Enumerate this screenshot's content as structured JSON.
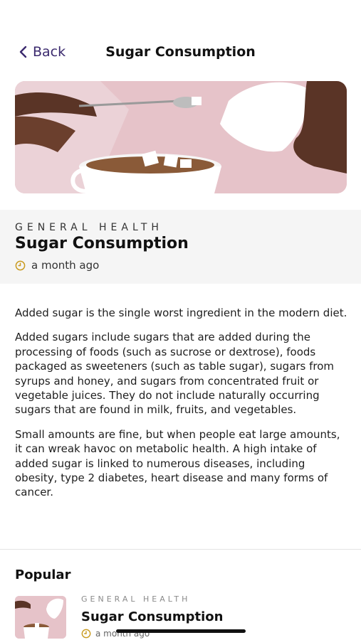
{
  "nav": {
    "back_label": "Back",
    "title": "Sugar Consumption"
  },
  "article": {
    "category": "GENERAL HEALTH",
    "title": "Sugar Consumption",
    "date": "a month ago",
    "paragraphs": [
      "Added sugar is the single worst ingredient in the modern diet.",
      "Added sugars include sugars that are added during the processing of foods (such as sucrose or dextrose), foods packaged as sweeteners (such as table sugar), sugars from syrups and honey, and sugars from concentrated fruit or vegetable juices. They do not include naturally occurring sugars that are found in milk, fruits, and vegetables.",
      "Small amounts are fine, but when people eat large amounts, it can wreak havoc on metabolic health. A high intake of added sugar is linked to numerous diseases, including obesity, type 2 diabetes, heart disease and many forms of cancer."
    ]
  },
  "popular": {
    "heading": "Popular",
    "items": [
      {
        "category": "GENERAL HEALTH",
        "title": "Sugar Consumption",
        "date": "a month ago"
      }
    ]
  },
  "colors": {
    "accent": "#3b2a6e",
    "clock": "#c99a1e",
    "hero_bg": "#e9c6cc"
  },
  "icons": {
    "back": "chevron-left-icon",
    "date": "clock-icon"
  }
}
